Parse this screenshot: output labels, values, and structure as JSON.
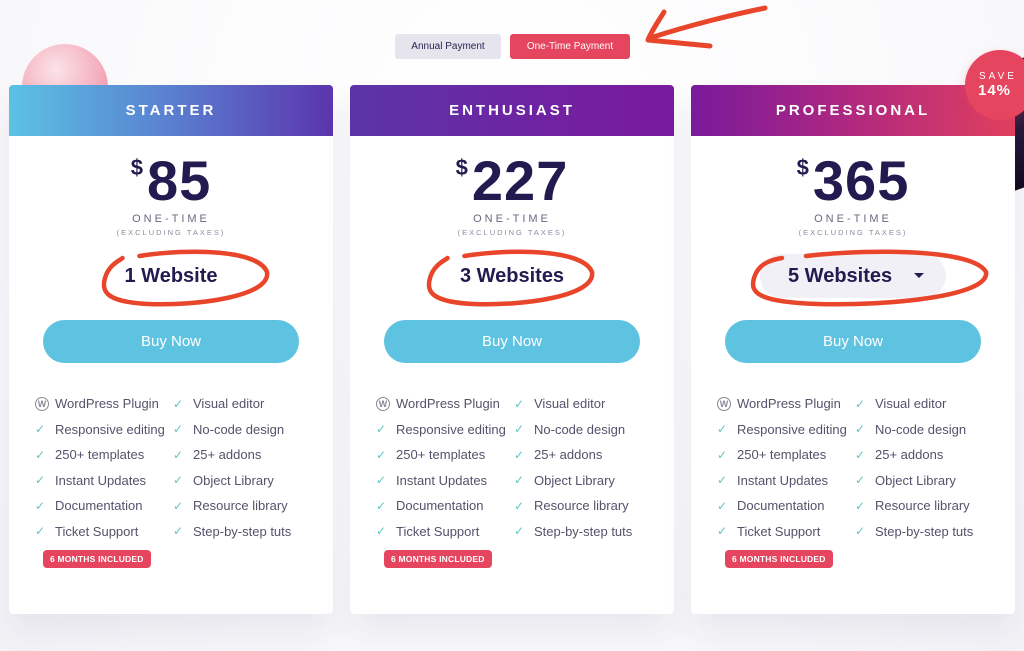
{
  "payment_toggle": {
    "options": [
      {
        "label": "Annual Payment",
        "active": false
      },
      {
        "label": "One-Time Payment",
        "active": true
      }
    ]
  },
  "save_badge": {
    "line1": "SAVE",
    "line2": "14%"
  },
  "colors": {
    "accent": "#e5455e",
    "buy_button": "#5ec3e1",
    "price_text": "#231a4f",
    "check": "#5fc4c4"
  },
  "plans": [
    {
      "name": "STARTER",
      "currency": "$",
      "price": "85",
      "billing": "ONE-TIME",
      "tax_note": "(EXCLUDING TAXES)",
      "websites": "1 Website",
      "websites_is_dropdown": false,
      "buy_label": "Buy Now",
      "badge": "6 MONTHS INCLUDED"
    },
    {
      "name": "ENTHUSIAST",
      "currency": "$",
      "price": "227",
      "billing": "ONE-TIME",
      "tax_note": "(EXCLUDING TAXES)",
      "websites": "3 Websites",
      "websites_is_dropdown": false,
      "buy_label": "Buy Now",
      "badge": "6 MONTHS INCLUDED"
    },
    {
      "name": "PROFESSIONAL",
      "currency": "$",
      "price": "365",
      "billing": "ONE-TIME",
      "tax_note": "(EXCLUDING TAXES)",
      "websites": "5 Websites",
      "websites_is_dropdown": true,
      "buy_label": "Buy Now",
      "badge": "6 MONTHS INCLUDED"
    }
  ],
  "features": [
    {
      "label": "WordPress Plugin",
      "icon": "wordpress-icon"
    },
    {
      "label": "Visual editor",
      "icon": "check-icon"
    },
    {
      "label": "Responsive editing",
      "icon": "check-icon"
    },
    {
      "label": "No-code design",
      "icon": "check-icon"
    },
    {
      "label": "250+ templates",
      "icon": "check-icon"
    },
    {
      "label": "25+ addons",
      "icon": "check-icon"
    },
    {
      "label": "Instant Updates",
      "icon": "check-icon"
    },
    {
      "label": "Object Library",
      "icon": "check-icon"
    },
    {
      "label": "Documentation",
      "icon": "check-icon"
    },
    {
      "label": "Resource library",
      "icon": "check-icon"
    },
    {
      "label": "Ticket Support",
      "icon": "check-icon"
    },
    {
      "label": "Step-by-step tuts",
      "icon": "check-icon"
    }
  ]
}
